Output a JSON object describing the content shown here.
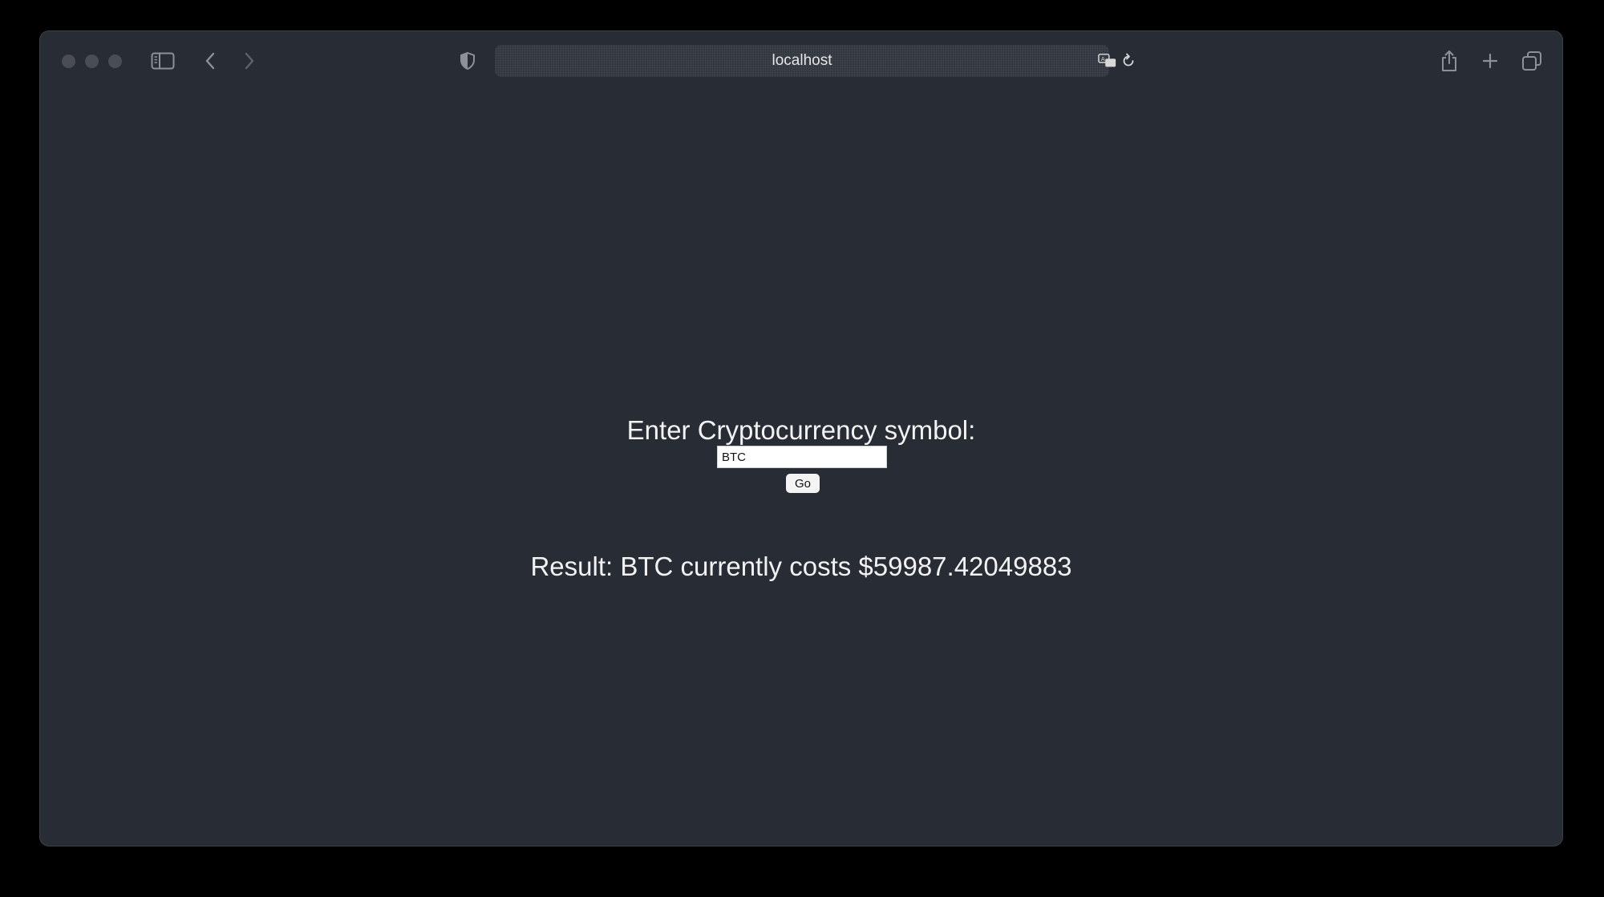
{
  "browser": {
    "url": "localhost",
    "icons": {
      "sidebar": "sidebar-icon",
      "back": "chevron-left-icon",
      "forward": "chevron-right-icon",
      "privacy": "shield-icon",
      "translate": "translate-icon",
      "reload": "reload-icon",
      "share": "share-icon",
      "new_tab": "plus-icon",
      "tab_overview": "tabs-icon"
    }
  },
  "page": {
    "prompt": "Enter Cryptocurrency symbol:",
    "symbol_value": "BTC",
    "go_label": "Go",
    "result_text": "Result: BTC currently costs $59987.42049883"
  },
  "colors": {
    "page_background": "#282c35",
    "text": "#f2f2f2"
  }
}
